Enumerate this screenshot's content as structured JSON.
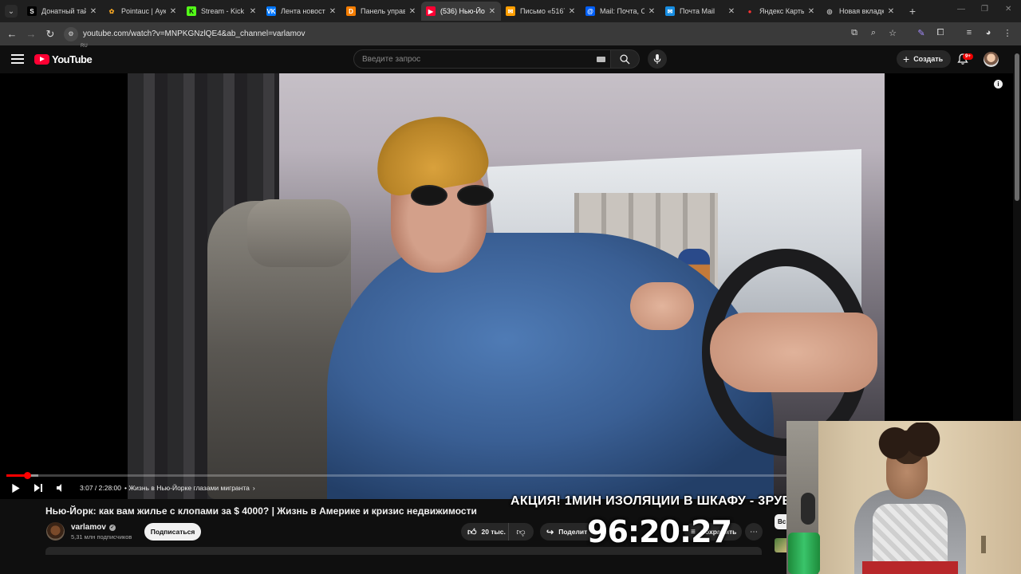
{
  "browser": {
    "tab_list_icon": "chevron-down",
    "tabs": [
      {
        "title": "Донатный тайм",
        "favicon": "S",
        "favicon_color": "#ffffff",
        "favicon_bg": "#000000",
        "active": false
      },
      {
        "title": "Pointauc | Аукц",
        "favicon": "✿",
        "favicon_color": "#f5a623",
        "favicon_bg": "transparent",
        "active": false
      },
      {
        "title": "Stream - Kick C",
        "favicon": "K",
        "favicon_color": "#0f0f0f",
        "favicon_bg": "#53fc18",
        "active": false
      },
      {
        "title": "Лента новосте",
        "favicon": "VK",
        "favicon_color": "#ffffff",
        "favicon_bg": "#0077ff",
        "active": false
      },
      {
        "title": "Панель управ",
        "favicon": "D",
        "favicon_color": "#ffffff",
        "favicon_bg": "#f57d00",
        "active": false
      },
      {
        "title": "(536) Нью-Йор",
        "favicon": "▶",
        "favicon_color": "#ffffff",
        "favicon_bg": "#ff0033",
        "active": true
      },
      {
        "title": "Письмо «5167",
        "favicon": "✉",
        "favicon_color": "#ffffff",
        "favicon_bg": "#ff9e00",
        "active": false
      },
      {
        "title": "Mail: Почта, О",
        "favicon": "@",
        "favicon_color": "#ffffff",
        "favicon_bg": "#005ff9",
        "active": false
      },
      {
        "title": "Почта Mail",
        "favicon": "✉",
        "favicon_color": "#ffffff",
        "favicon_bg": "#168de2",
        "active": false
      },
      {
        "title": "Яндекс Карты",
        "favicon": "●",
        "favicon_color": "#ff3333",
        "favicon_bg": "transparent",
        "active": false
      },
      {
        "title": "Новая вкладка",
        "favicon": "◎",
        "favicon_color": "#cccccc",
        "favicon_bg": "transparent",
        "active": false
      }
    ],
    "new_tab_label": "+",
    "url": "youtube.com/watch?v=MNPKGNzlQE4&ab_channel=varlamov"
  },
  "youtube": {
    "logo_text": "YouTube",
    "logo_region": "RU",
    "search_placeholder": "Введите запрос",
    "create_label": "Создать",
    "notifications_badge": "9+",
    "player": {
      "current_time": "3:07",
      "duration": "2:28:00",
      "time_display": "3:07 / 2:28:00",
      "chapter": "• Жизнь в Нью-Йорке глазами мигранта",
      "played_fraction": 0.021,
      "buffered_fraction": 0.032
    },
    "video_title": "Нью-Йорк: как вам жилье с клопами за $ 4000? | Жизнь в Америке и кризис недвижимости",
    "channel_name": "varlamov",
    "subscribers": "5,31 млн подписчиков",
    "subscribe_label": "Подписаться",
    "likes_label": "20 тыс.",
    "share_label": "Поделит",
    "save_label": "Сохранить",
    "chip_label": "Вс"
  },
  "overlay": {
    "promo_text": "АКЦИЯ! 1МИН ИЗОЛЯЦИИ В ШКАФУ - 3РУБ",
    "timer": "96:20:27"
  },
  "colors": {
    "accent": "#ff0000",
    "background": "#0f0f0f"
  }
}
